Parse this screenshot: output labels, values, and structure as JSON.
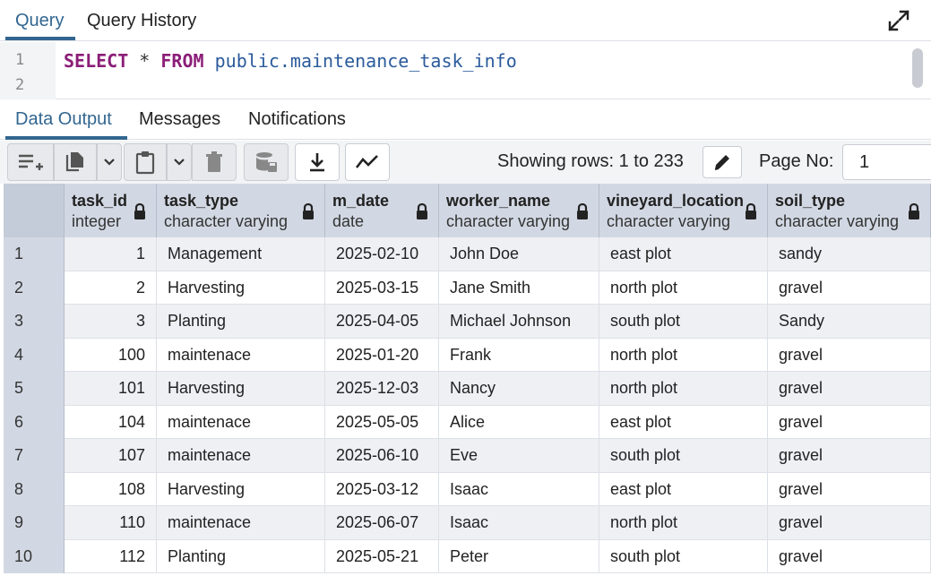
{
  "top_tabs": [
    "Query",
    "Query History"
  ],
  "editor": {
    "line_numbers": [
      "1",
      "2"
    ],
    "code": {
      "kw1": "SELECT",
      "op": "*",
      "kw2": "FROM",
      "ident": "public.maintenance_task_info"
    }
  },
  "output_tabs": [
    "Data Output",
    "Messages",
    "Notifications"
  ],
  "toolbar": {
    "rows_info": "Showing rows: 1 to 233",
    "page_label": "Page No:",
    "page_value": "1"
  },
  "table": {
    "columns": [
      {
        "name": "task_id",
        "type": "integer"
      },
      {
        "name": "task_type",
        "type": "character varying"
      },
      {
        "name": "m_date",
        "type": "date"
      },
      {
        "name": "worker_name",
        "type": "character varying"
      },
      {
        "name": "vineyard_location",
        "type": "character varying"
      },
      {
        "name": "soil_type",
        "type": "character varying"
      }
    ],
    "rows": [
      [
        "1",
        "1",
        "Management",
        "2025-02-10",
        "John Doe",
        "east plot",
        "sandy"
      ],
      [
        "2",
        "2",
        "Harvesting",
        "2025-03-15",
        "Jane Smith",
        "north  plot",
        "gravel"
      ],
      [
        "3",
        "3",
        "Planting",
        "2025-04-05",
        "Michael Johnson",
        "south plot",
        "Sandy"
      ],
      [
        "4",
        "100",
        "maintenace",
        "2025-01-20",
        "Frank",
        "north  plot",
        "gravel"
      ],
      [
        "5",
        "101",
        "Harvesting",
        "2025-12-03",
        "Nancy",
        "north  plot",
        "gravel"
      ],
      [
        "6",
        "104",
        "maintenace",
        "2025-05-05",
        "Alice",
        "east plot",
        "gravel"
      ],
      [
        "7",
        "107",
        "maintenace",
        "2025-06-10",
        "Eve",
        "south plot",
        "gravel"
      ],
      [
        "8",
        "108",
        "Harvesting",
        "2025-03-12",
        "Isaac",
        "east plot",
        "gravel"
      ],
      [
        "9",
        "110",
        "maintenace",
        "2025-06-07",
        "Isaac",
        "north  plot",
        "gravel"
      ],
      [
        "10",
        "112",
        "Planting",
        "2025-05-21",
        "Peter",
        "south plot",
        "gravel"
      ]
    ]
  },
  "colors": {
    "accent": "#326690",
    "keyword": "#8b1e78",
    "identifier": "#2b5b9b",
    "header_bg": "#d2d8e3"
  }
}
